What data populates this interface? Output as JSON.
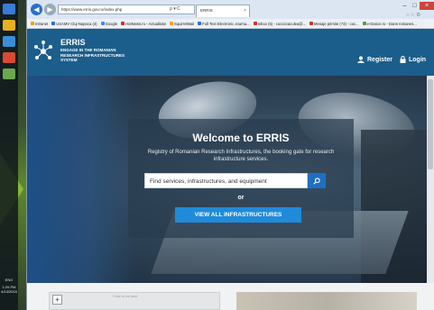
{
  "browser": {
    "address_url": "https://www.erris.gov.ro/index.php",
    "address_tools": "ρ ▾ C",
    "tab_title": "ERRIS",
    "bookmarks": [
      {
        "label": "Intranet",
        "color": "#e2a319"
      },
      {
        "label": "USAMV Cluj-Napoca (4)",
        "color": "#2f6fbf"
      },
      {
        "label": "Google",
        "color": "#4285f4"
      },
      {
        "label": "HotNews.ro - Actualitate",
        "color": "#c6322b"
      },
      {
        "label": "SquirrelMail",
        "color": "#f2a526"
      },
      {
        "label": "Full Text Electronic Journa...",
        "color": "#2f6fbf"
      },
      {
        "label": "Inbox (5) - cococcaculea@...",
        "color": "#c6322b"
      },
      {
        "label": "Mesaje primite (73) - coc...",
        "color": "#c6322b"
      },
      {
        "label": "e-Dance.ro - Dans romanes...",
        "color": "#5b9a2f"
      }
    ]
  },
  "taskbar": {
    "lang": "ENG",
    "time": "1:29 PM",
    "date": "4/13/2015"
  },
  "header": {
    "brand": "ERRIS",
    "brand_sub": "Engage in the Romanian Research Infrastructures System",
    "register_label": "Register",
    "login_label": "Login"
  },
  "hero": {
    "title": "Welcome to ERRIS",
    "tagline": "Registry of Romanian Research Infrastructures, the booking gate for research infrastructure services.",
    "search_text": "Find services, infrastructures, and equipment",
    "or_label": "or",
    "view_all_label": "VIEW ALL INFRASTRUCTURES"
  },
  "lower": {
    "zoom_label": "+",
    "map_caption": "Click to be sure"
  },
  "colors": {
    "header_bg": "#1b5e8c",
    "accent_button": "#1f8bd9",
    "search_button": "#1f6fc1"
  }
}
